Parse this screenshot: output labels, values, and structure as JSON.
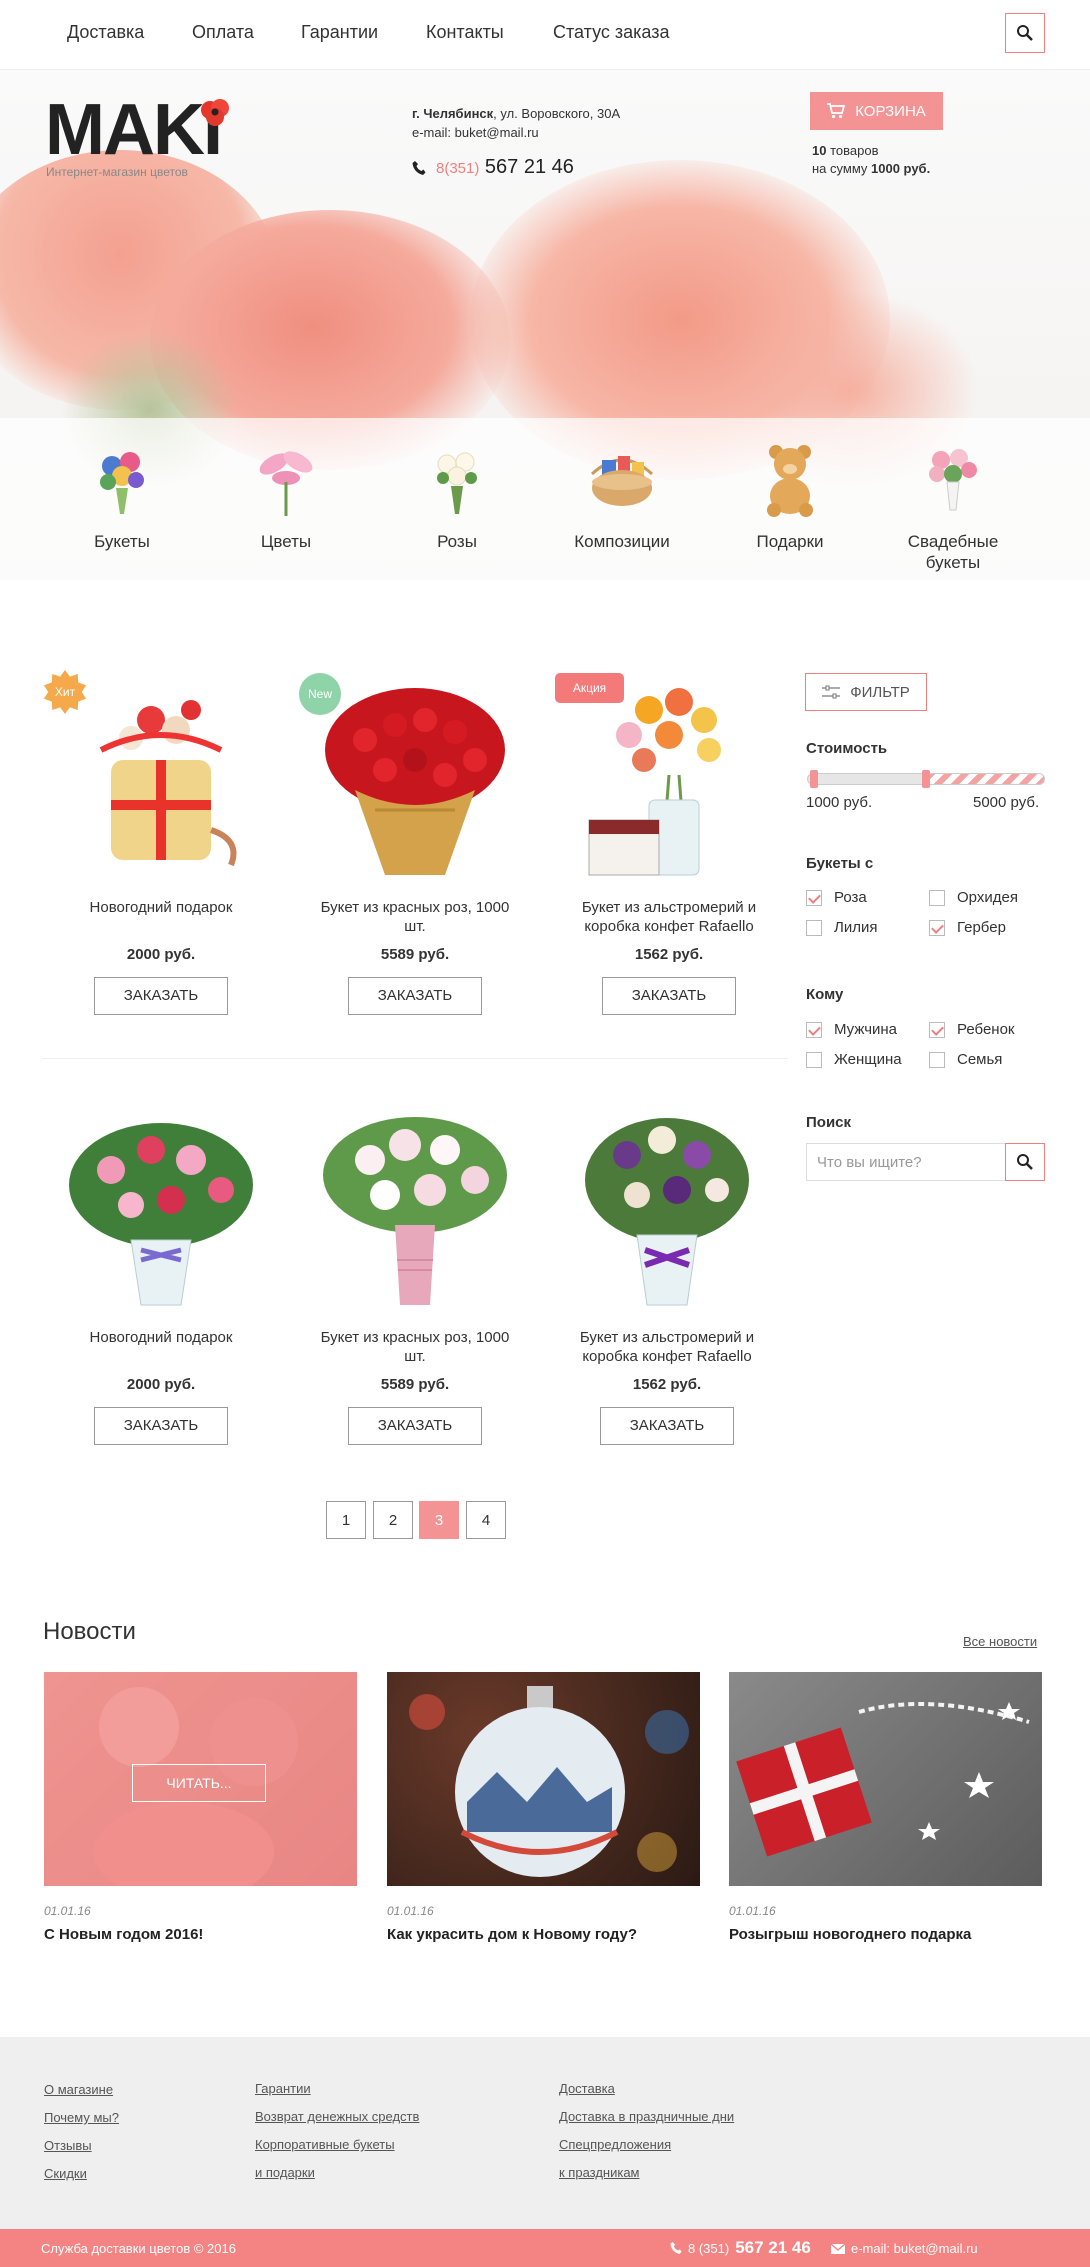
{
  "nav": {
    "items": [
      "Доставка",
      "Оплата",
      "Гарантии",
      "Контакты",
      "Статус заказа"
    ]
  },
  "header": {
    "logo": "MAKI",
    "logo_sub": "Интернет-магазин цветов",
    "city": "г. Челябинск",
    "address": ", ул. Воровского, 30А",
    "email": "e-mail: buket@mail.ru",
    "phone_code": "8(351)",
    "phone_number": "567 21 46",
    "cart_label": "КОРЗИНА",
    "cart_count": "10",
    "cart_count_suffix": " товаров",
    "cart_sum_prefix": "на сумму ",
    "cart_sum": "1000 руб."
  },
  "categories": [
    {
      "label": "Букеты",
      "icon": "bouquet-icon"
    },
    {
      "label": "Цветы",
      "icon": "lily-icon"
    },
    {
      "label": "Розы",
      "icon": "roses-icon"
    },
    {
      "label": "Композиции",
      "icon": "basket-icon"
    },
    {
      "label": "Подарки",
      "icon": "teddy-bear-icon"
    },
    {
      "label": "Свадебные букеты",
      "icon": "wedding-bouquet-icon"
    }
  ],
  "products": [
    {
      "name": "Новогодний подарок",
      "price": "2000 руб.",
      "order": "ЗАКАЗАТЬ",
      "badge": "Хит"
    },
    {
      "name": "Букет из красных роз, 1000 шт.",
      "price": "5589 руб.",
      "order": "ЗАКАЗАТЬ",
      "badge": "New"
    },
    {
      "name": "Букет из альстромерий и коробка конфет Rafaello",
      "price": "1562 руб.",
      "order": "ЗАКАЗАТЬ",
      "badge": "Акция"
    },
    {
      "name": "Новогодний подарок",
      "price": "2000 руб.",
      "order": "ЗАКАЗАТЬ",
      "badge": ""
    },
    {
      "name": "Букет из красных роз, 1000 шт.",
      "price": "5589 руб.",
      "order": "ЗАКАЗАТЬ",
      "badge": ""
    },
    {
      "name": "Букет из альстромерий и коробка конфет Rafaello",
      "price": "1562 руб.",
      "order": "ЗАКАЗАТЬ",
      "badge": ""
    }
  ],
  "filter": {
    "button": "ФИЛЬТР",
    "price_title": "Стоимость",
    "price_min": "1000 руб.",
    "price_max": "5000 руб.",
    "price_selected_fraction": 0.5,
    "flowers_title": "Букеты с",
    "flowers": [
      {
        "label": "Роза",
        "checked": true
      },
      {
        "label": "Орхидея",
        "checked": false
      },
      {
        "label": "Лилия",
        "checked": false
      },
      {
        "label": "Гербер",
        "checked": true
      }
    ],
    "whom_title": "Кому",
    "whom": [
      {
        "label": "Мужчина",
        "checked": true
      },
      {
        "label": "Ребенок",
        "checked": true
      },
      {
        "label": "Женщина",
        "checked": false
      },
      {
        "label": "Семья",
        "checked": false
      }
    ],
    "search_title": "Поиск",
    "search_placeholder": "Что вы ищите?"
  },
  "pagination": {
    "pages": [
      "1",
      "2",
      "3",
      "4"
    ],
    "active": "3"
  },
  "news": {
    "title": "Новости",
    "all_link": "Все новости",
    "read_label": "ЧИТАТЬ...",
    "items": [
      {
        "date": "01.01.16",
        "title": "С Новым годом 2016!"
      },
      {
        "date": "01.01.16",
        "title": "Как украсить дом к Новому году?"
      },
      {
        "date": "01.01.16",
        "title": "Розыгрыш новогоднего подарка"
      }
    ]
  },
  "footer": {
    "col1": [
      "О магазине",
      "Почему мы?",
      "Отзывы",
      "Скидки"
    ],
    "col2": [
      "Гарантии",
      "Возврат денежных средств",
      "Корпоративные букеты ",
      "и подарки"
    ],
    "col3": [
      "Доставка",
      "Доставка в праздничные дни",
      "Спецпредложения ",
      "к праздникам"
    ],
    "service": "Служба доставки цветов © 2016",
    "phone_code": "8 (351)",
    "phone_number": "567 21 46",
    "email": "e-mail: buket@mail.ru"
  },
  "colors": {
    "accent": "#f49393",
    "badge_hit": "#f6a94a",
    "badge_new": "#8fd3a8",
    "badge_sale": "#f47a7a"
  }
}
